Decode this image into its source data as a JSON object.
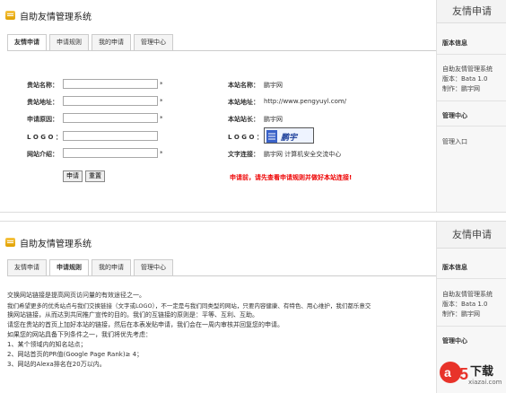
{
  "app": {
    "title": "自助友情管理系统"
  },
  "tabs": [
    {
      "label": "友情申请"
    },
    {
      "label": "申请规则"
    },
    {
      "label": "我的申请"
    },
    {
      "label": "管理中心"
    }
  ],
  "form": {
    "fields": [
      {
        "label": "贵站名称：",
        "value": "",
        "required": "*"
      },
      {
        "label": "贵站地址：",
        "value": "",
        "required": "*"
      },
      {
        "label": "申请原因：",
        "value": "",
        "required": "*"
      },
      {
        "label": "L O G O ：",
        "value": "",
        "required": ""
      },
      {
        "label": "网站介绍：",
        "value": "",
        "required": "*"
      }
    ],
    "submit_label": "申请",
    "reset_label": "重置"
  },
  "site_info": [
    {
      "label": "本站名称：",
      "value": "鹏宇网"
    },
    {
      "label": "本站地址：",
      "value": "http://www.pengyuyl.com/"
    },
    {
      "label": "本站站长：",
      "value": "鹏宇网"
    },
    {
      "label": "L O G O ：",
      "value": ""
    },
    {
      "label": "文字连接：",
      "value": "鹏宇网 计算机安全交流中心"
    }
  ],
  "logo_text": "鹏宇",
  "notice": "申请前，请先查看申请规则并做好本站连接!",
  "sidebar": {
    "title": "友情申请",
    "version_heading": "版本信息",
    "version_lines": [
      "自助友情管理系统",
      "版本：Bata 1.0",
      "制作：鹏宇网"
    ],
    "admin_heading": "管理中心",
    "admin_link": "管理入口"
  },
  "rules": {
    "lines": [
      "交换网站链接是提高网页访问量的有效途径之一。",
      "我们希望更多的优秀站点与我们交换链接（文字或LOGO），不一定是与我们同类型的网站，只要内容健康、有特色、用心维护，我们都乐意交",
      "换网站链接，从而达到共同推广宣传的目的。我们的互链接的原则是：平等、互利、互助。",
      "请您在贵站的首页上加好本站的链接，然后在本表发贴申请，我们会在一周内审核并回复您的申请。",
      "如果您的网站具备下列条件之一，我们将优先考虑：",
      "1、某个领域内的知名站点；",
      "2、网站首页的PR值(Google Page Rank)≥ 4；",
      "3、网站的Alexa排名在20万以内。"
    ]
  },
  "watermark": {
    "brand": "下载",
    "domain": "xiazai.com"
  }
}
